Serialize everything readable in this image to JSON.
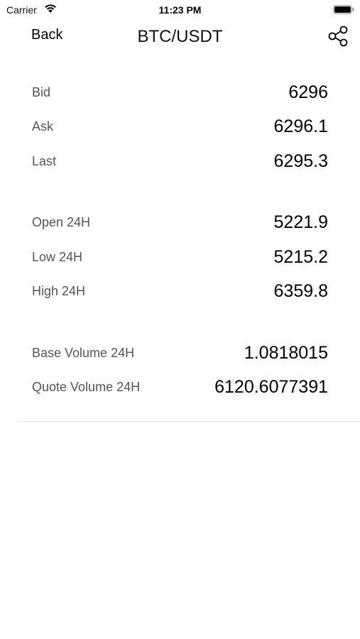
{
  "status_bar": {
    "carrier": "Carrier",
    "time": "11:23 PM",
    "wifi_icon": "wifi-icon",
    "battery_icon": "battery-icon"
  },
  "nav": {
    "back_label": "Back",
    "title": "BTC/USDT",
    "share_icon": "share-icon"
  },
  "groups": [
    {
      "rows": [
        {
          "label": "Bid",
          "value": "6296"
        },
        {
          "label": "Ask",
          "value": "6296.1"
        },
        {
          "label": "Last",
          "value": "6295.3"
        }
      ]
    },
    {
      "rows": [
        {
          "label": "Open 24H",
          "value": "5221.9"
        },
        {
          "label": "Low 24H",
          "value": "5215.2"
        },
        {
          "label": "High 24H",
          "value": "6359.8"
        }
      ]
    },
    {
      "rows": [
        {
          "label": "Base Volume 24H",
          "value": "1.0818015"
        },
        {
          "label": "Quote Volume 24H",
          "value": "6120.6077391"
        }
      ]
    }
  ]
}
